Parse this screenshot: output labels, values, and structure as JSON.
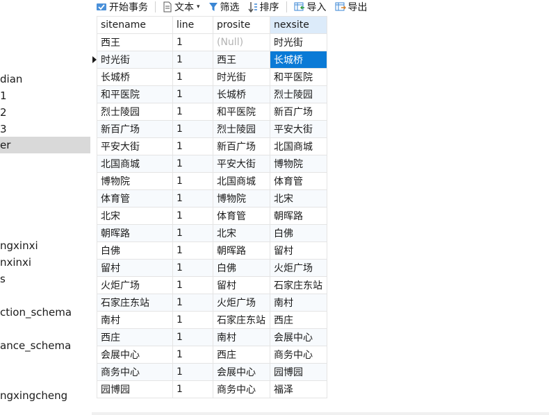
{
  "toolbar": {
    "begin_transaction": "开始事务",
    "text": "文本",
    "filter": "筛选",
    "sort": "排序",
    "import": "导入",
    "export": "导出"
  },
  "sidebar": {
    "items": [
      "dian",
      "1",
      "2",
      "3",
      "er",
      "ngxinxi",
      "nxinxi",
      "s",
      "ction_schema",
      "ance_schema",
      "ngxingcheng"
    ],
    "selected_index": 4
  },
  "grid": {
    "columns": [
      "sitename",
      "line",
      "prosite",
      "nexsite"
    ],
    "null_label": "(Null)",
    "current_row": 1,
    "selected_cell": {
      "row": 1,
      "col": 3
    },
    "rows": [
      [
        "西王",
        "1",
        null,
        "时光街"
      ],
      [
        "时光街",
        "1",
        "西王",
        "长城桥"
      ],
      [
        "长城桥",
        "1",
        "时光街",
        "和平医院"
      ],
      [
        "和平医院",
        "1",
        "长城桥",
        "烈士陵园"
      ],
      [
        "烈士陵园",
        "1",
        "和平医院",
        "新百广场"
      ],
      [
        "新百广场",
        "1",
        "烈士陵园",
        "平安大街"
      ],
      [
        "平安大街",
        "1",
        "新百广场",
        "北国商城"
      ],
      [
        "北国商城",
        "1",
        "平安大街",
        "博物院"
      ],
      [
        "博物院",
        "1",
        "北国商城",
        "体育管"
      ],
      [
        "体育管",
        "1",
        "博物院",
        "北宋"
      ],
      [
        "北宋",
        "1",
        "体育管",
        "朝晖路"
      ],
      [
        "朝晖路",
        "1",
        "北宋",
        "白佛"
      ],
      [
        "白佛",
        "1",
        "朝晖路",
        "留村"
      ],
      [
        "留村",
        "1",
        "白佛",
        "火炬广场"
      ],
      [
        "火炬广场",
        "1",
        "留村",
        "石家庄东站"
      ],
      [
        "石家庄东站",
        "1",
        "火炬广场",
        "南村"
      ],
      [
        "南村",
        "1",
        "石家庄东站",
        "西庄"
      ],
      [
        "西庄",
        "1",
        "南村",
        "会展中心"
      ],
      [
        "会展中心",
        "1",
        "西庄",
        "商务中心"
      ],
      [
        "商务中心",
        "1",
        "会展中心",
        "园博园"
      ],
      [
        "园博园",
        "1",
        "商务中心",
        "福泽"
      ]
    ]
  }
}
